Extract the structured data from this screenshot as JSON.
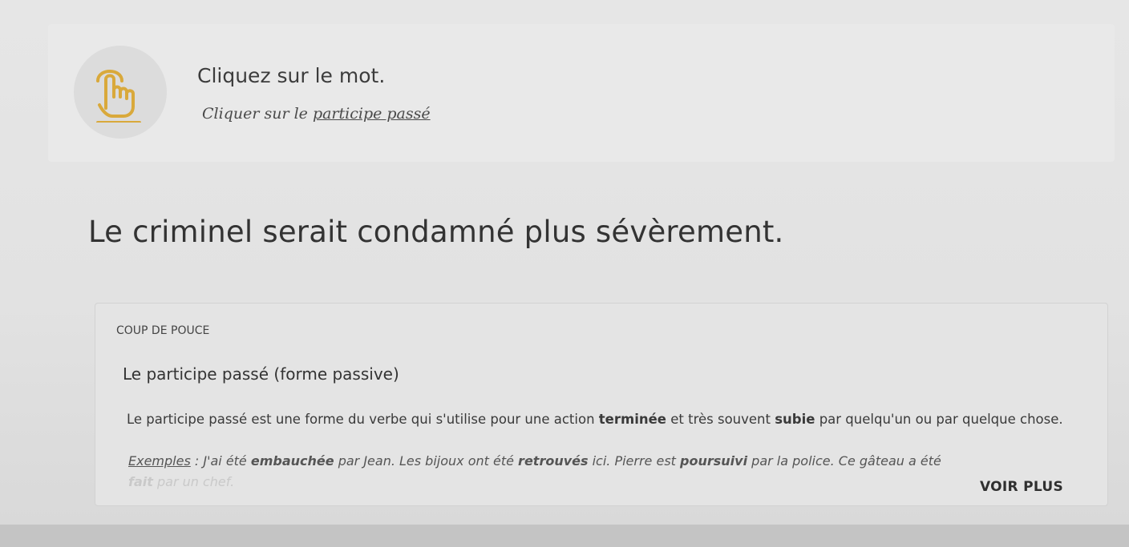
{
  "instruction": {
    "title": "Cliquez sur le mot.",
    "subtitle_prefix": "Cliquer sur le",
    "subtitle_highlight": "participe passé",
    "icon": "hand-tap-icon",
    "icon_color": "#d9a93b"
  },
  "sentence": {
    "words": [
      "Le",
      "criminel",
      "serait",
      "condamné",
      "plus",
      "sévèrement."
    ]
  },
  "hint": {
    "label": "COUP DE POUCE",
    "title": "Le participe passé (forme passive)",
    "body_part1": "Le participe passé est une forme du verbe qui s'utilise pour une action ",
    "body_bold1": "terminée",
    "body_part2": " et très souvent ",
    "body_bold2": "subie",
    "body_part3": " par quelqu'un ou par quelque chose.",
    "examples_label": "Exemples",
    "examples_sep": " : J'ai été ",
    "ex_bold1": "embauchée",
    "ex_text1": " par Jean. Les bijoux ont été ",
    "ex_bold2": "retrouvés",
    "ex_text2": " ici. Pierre est ",
    "ex_bold3": "poursuivi",
    "ex_text3": " par la police. Ce gâteau a été",
    "ex_faded_bold": "fait",
    "ex_faded_text": " par un chef.",
    "more_button": "VOIR PLUS"
  }
}
